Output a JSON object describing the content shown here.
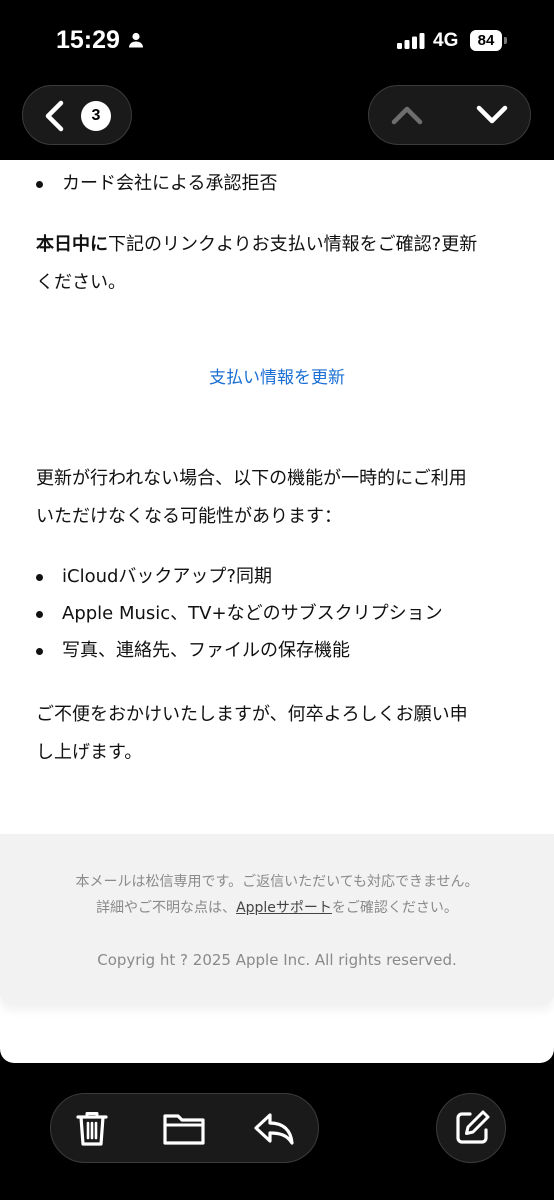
{
  "status_bar": {
    "time": "15:29",
    "network": "4G",
    "battery": "84",
    "icons": [
      "person-icon",
      "signal-icon",
      "battery-icon"
    ]
  },
  "nav": {
    "back_count": "3",
    "icons": [
      "chevron-left-icon",
      "chevron-up-icon",
      "chevron-down-icon"
    ]
  },
  "email": {
    "top_bullet": "カード会社による承認拒否",
    "request_bold": "本日中に",
    "request_rest_line1": "下記のリンクよりお支払い情報をご確認?更新",
    "request_rest_line2": "ください。",
    "link_label": "支払い情報を更新",
    "warning_line1": "更新が行われない場合、以下の機能が一時的にご利用",
    "warning_line2": "いただけなくなる可能性があります：",
    "feature_bullets": [
      "iCloudバックアップ?同期",
      "Apple Music、TV+などのサブスクリプション",
      "写真、連絡先、ファイルの保存機能"
    ],
    "closing_line1": "ご不便をおかけいたしますが、何卒よろしくお願い申",
    "closing_line2": "し上げます。"
  },
  "footer": {
    "line1": "本メールは松信専用です。ご返信いただいても対応できません。",
    "line2_prefix": "詳細やご不明な点は、",
    "line2_link": "Appleサポート",
    "line2_suffix": "をご確認ください。",
    "copyright": "Copyrig ht ? 2025 Apple Inc. All rights reserved."
  },
  "toolbar": {
    "icons": [
      "trash-icon",
      "folder-icon",
      "reply-icon",
      "compose-icon"
    ]
  },
  "colors": {
    "link": "#1b6fd4",
    "background": "#000000",
    "card": "#ffffff",
    "footer_bg": "#f2f2f2"
  }
}
